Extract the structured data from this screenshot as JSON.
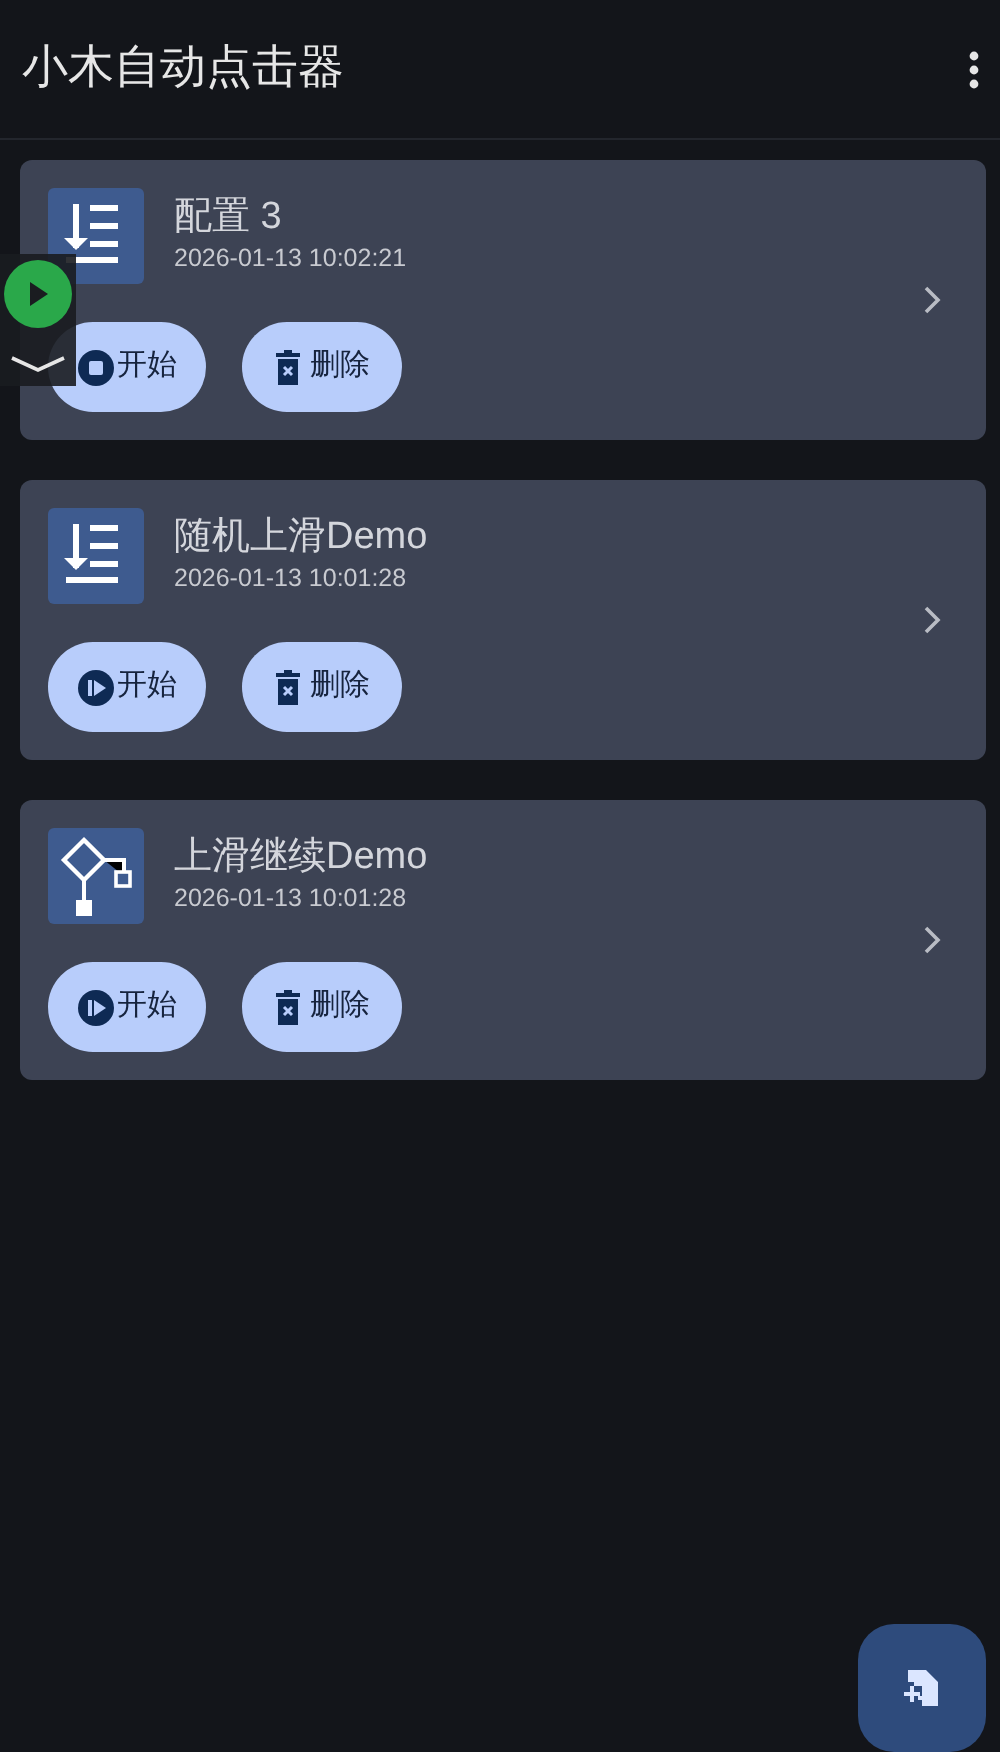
{
  "app_bar": {
    "title": "小木自动点击器"
  },
  "configs": [
    {
      "title": "配置 3",
      "timestamp": "2026-01-13 10:02:21",
      "kind": "list",
      "running": true,
      "start_label": "开始",
      "delete_label": "删除"
    },
    {
      "title": "随机上滑Demo",
      "timestamp": "2026-01-13 10:01:28",
      "kind": "list",
      "running": false,
      "start_label": "开始",
      "delete_label": "删除"
    },
    {
      "title": "上滑继续Demo",
      "timestamp": "2026-01-13 10:01:28",
      "kind": "flow",
      "running": false,
      "start_label": "开始",
      "delete_label": "删除"
    }
  ]
}
